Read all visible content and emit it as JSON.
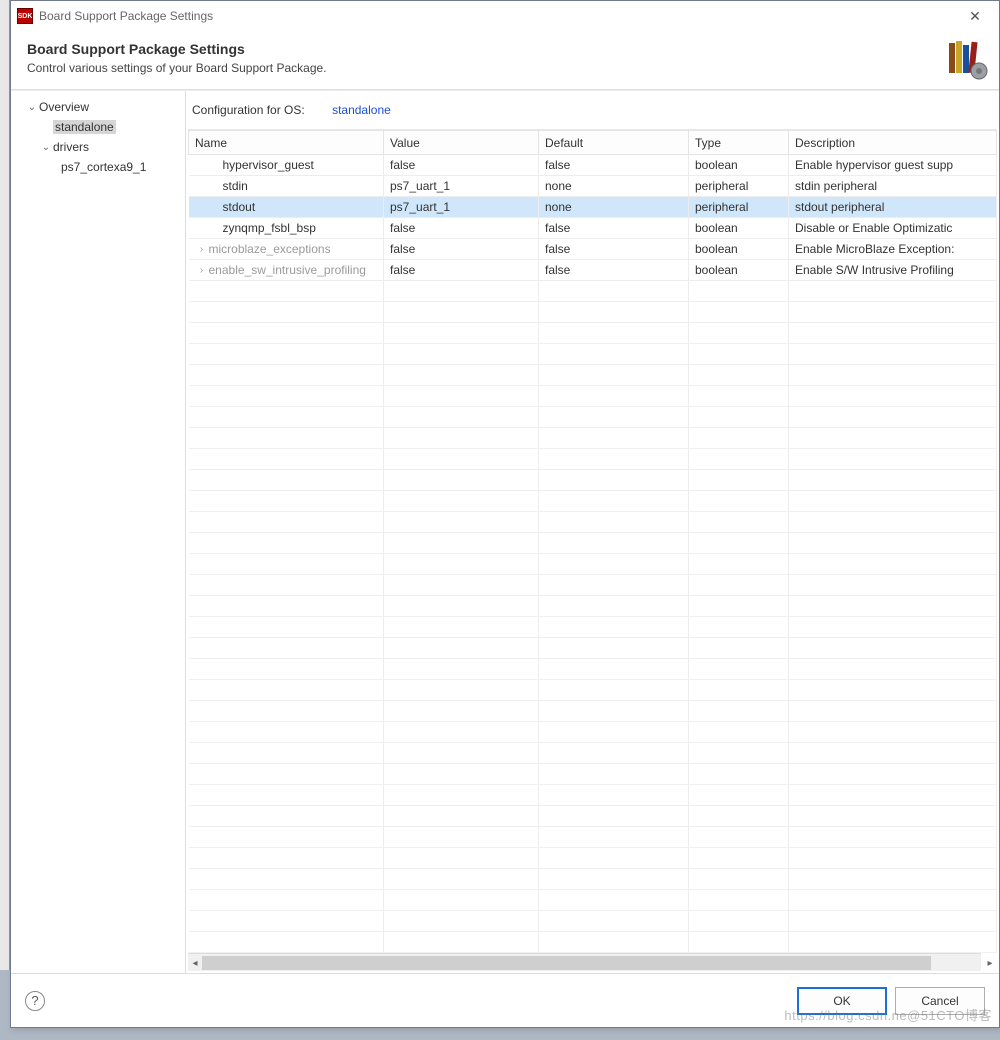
{
  "window": {
    "title": "Board Support Package Settings",
    "app_icon_text": "SDK"
  },
  "header": {
    "title": "Board Support Package Settings",
    "subtitle": "Control various settings of your Board Support Package."
  },
  "tree": {
    "root": "Overview",
    "selected": "standalone",
    "drivers_label": "drivers",
    "driver_item": "ps7_cortexa9_1"
  },
  "config": {
    "label": "Configuration for OS:",
    "value": "standalone"
  },
  "table": {
    "columns": [
      "Name",
      "Value",
      "Default",
      "Type",
      "Description"
    ],
    "rows": [
      {
        "name": "hypervisor_guest",
        "value": "false",
        "default": "false",
        "type": "boolean",
        "desc": "Enable hypervisor guest supp",
        "expandable": false,
        "disabled": false,
        "state": ""
      },
      {
        "name": "stdin",
        "value": "ps7_uart_1",
        "default": "none",
        "type": "peripheral",
        "desc": "stdin peripheral",
        "expandable": false,
        "disabled": false,
        "state": ""
      },
      {
        "name": "stdout",
        "value": "ps7_uart_1",
        "default": "none",
        "type": "peripheral",
        "desc": "stdout peripheral",
        "expandable": false,
        "disabled": false,
        "state": "selected"
      },
      {
        "name": "zynqmp_fsbl_bsp",
        "value": "false",
        "default": "false",
        "type": "boolean",
        "desc": "Disable or Enable Optimizatic",
        "expandable": false,
        "disabled": false,
        "state": ""
      },
      {
        "name": "microblaze_exceptions",
        "value": "false",
        "default": "false",
        "type": "boolean",
        "desc": "Enable MicroBlaze Exception:",
        "expandable": true,
        "disabled": true,
        "state": ""
      },
      {
        "name": "enable_sw_intrusive_profiling",
        "value": "false",
        "default": "false",
        "type": "boolean",
        "desc": "Enable S/W Intrusive Profiling",
        "expandable": true,
        "disabled": true,
        "state": ""
      }
    ]
  },
  "footer": {
    "ok": "OK",
    "cancel": "Cancel"
  },
  "watermark": "https://blog.csdn.ne@51CTO博客"
}
